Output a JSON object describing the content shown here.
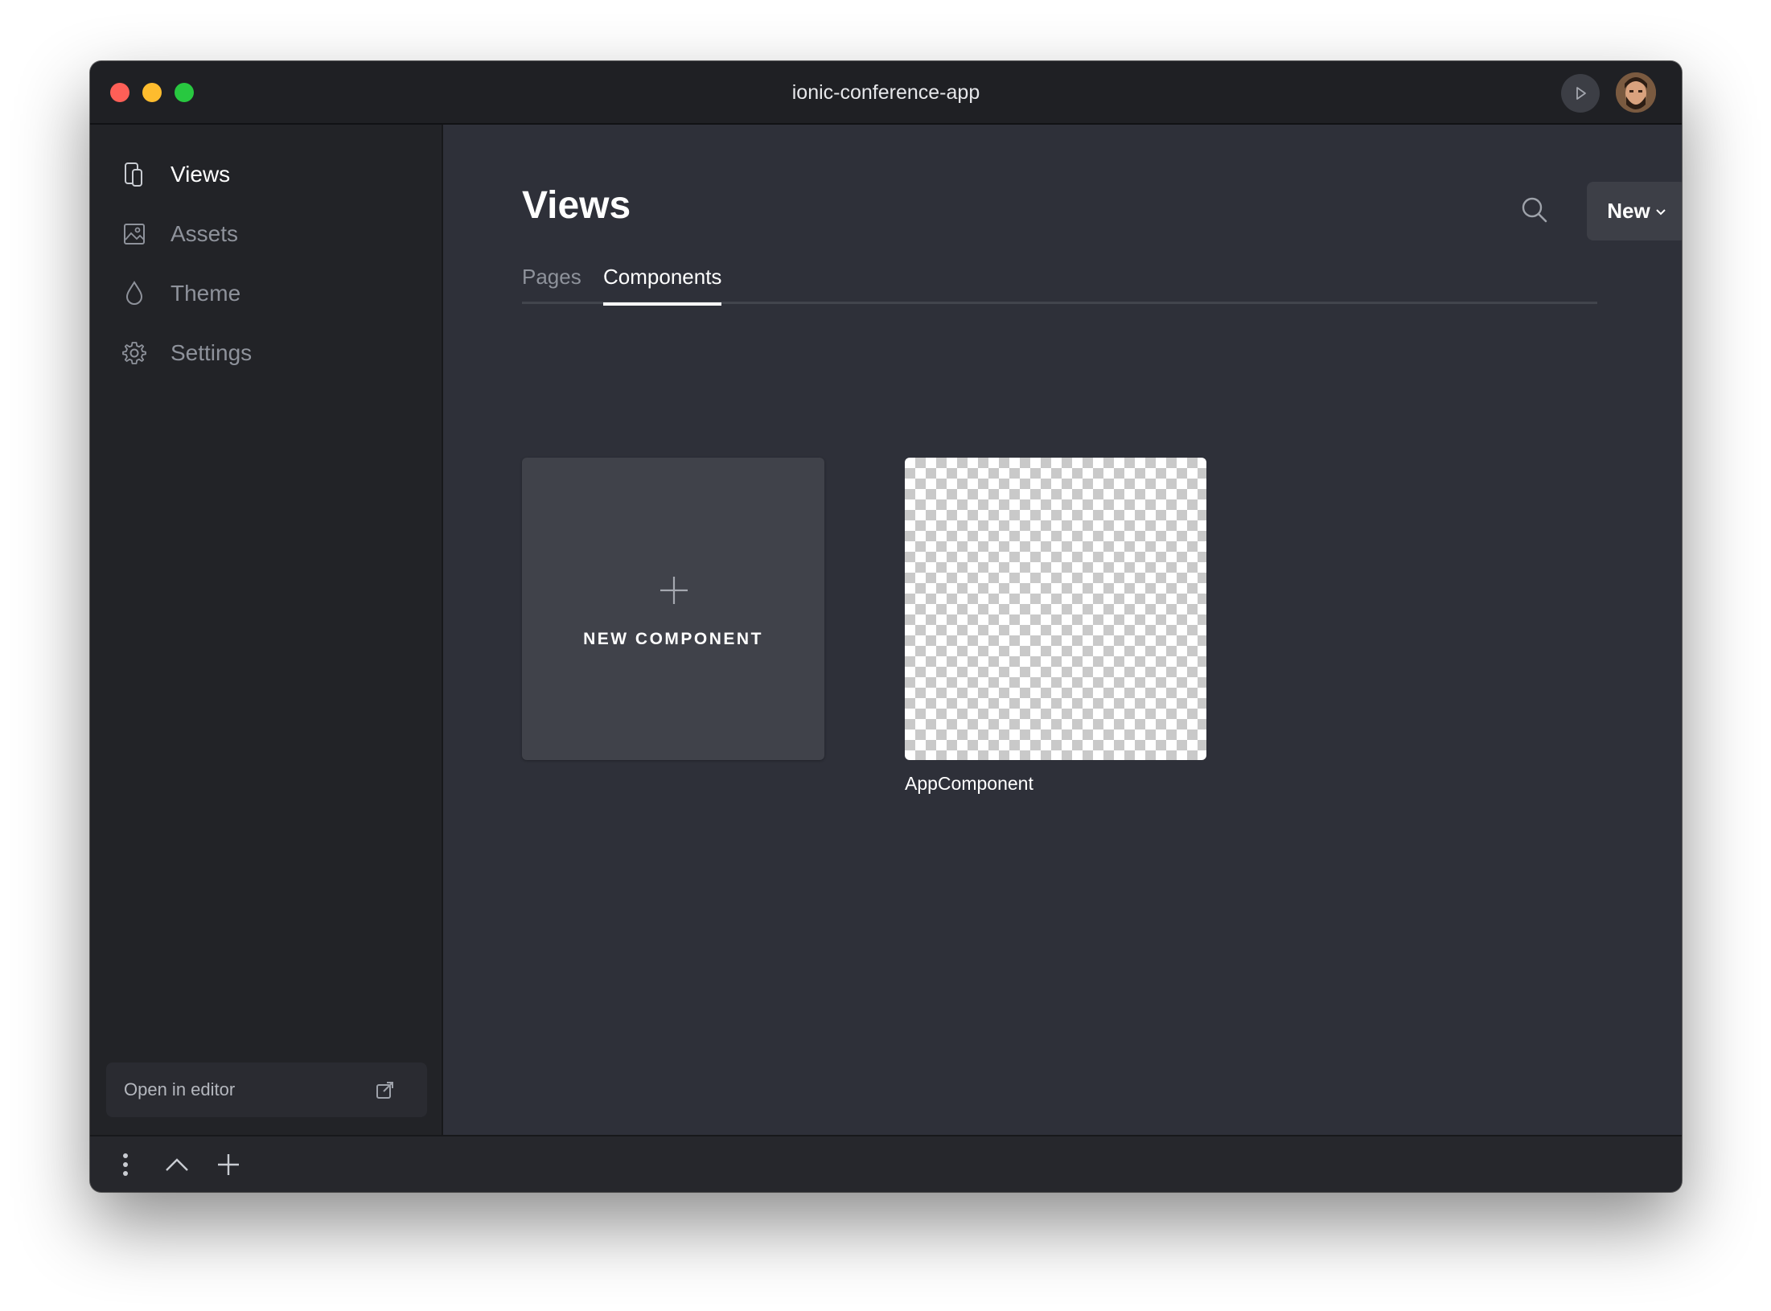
{
  "window": {
    "title": "ionic-conference-app"
  },
  "sidebar": {
    "items": [
      {
        "label": "Views",
        "icon": "devices-icon",
        "active": true
      },
      {
        "label": "Assets",
        "icon": "image-icon",
        "active": false
      },
      {
        "label": "Theme",
        "icon": "droplet-icon",
        "active": false
      },
      {
        "label": "Settings",
        "icon": "gear-icon",
        "active": false
      }
    ],
    "open_editor": {
      "label": "Open in editor",
      "icon": "external-link-icon"
    }
  },
  "main": {
    "title": "Views",
    "new_button": "New",
    "tabs": [
      {
        "label": "Pages",
        "active": false
      },
      {
        "label": "Components",
        "active": true
      }
    ],
    "cards": {
      "new_component": "NEW COMPONENT",
      "components": [
        {
          "name": "AppComponent"
        }
      ]
    }
  },
  "colors": {
    "background": "#2e3039",
    "sidebar": "#222327",
    "titlebar": "#1f2024",
    "card": "#40424a",
    "text_active": "#ffffff",
    "text_muted": "#8e929b"
  }
}
